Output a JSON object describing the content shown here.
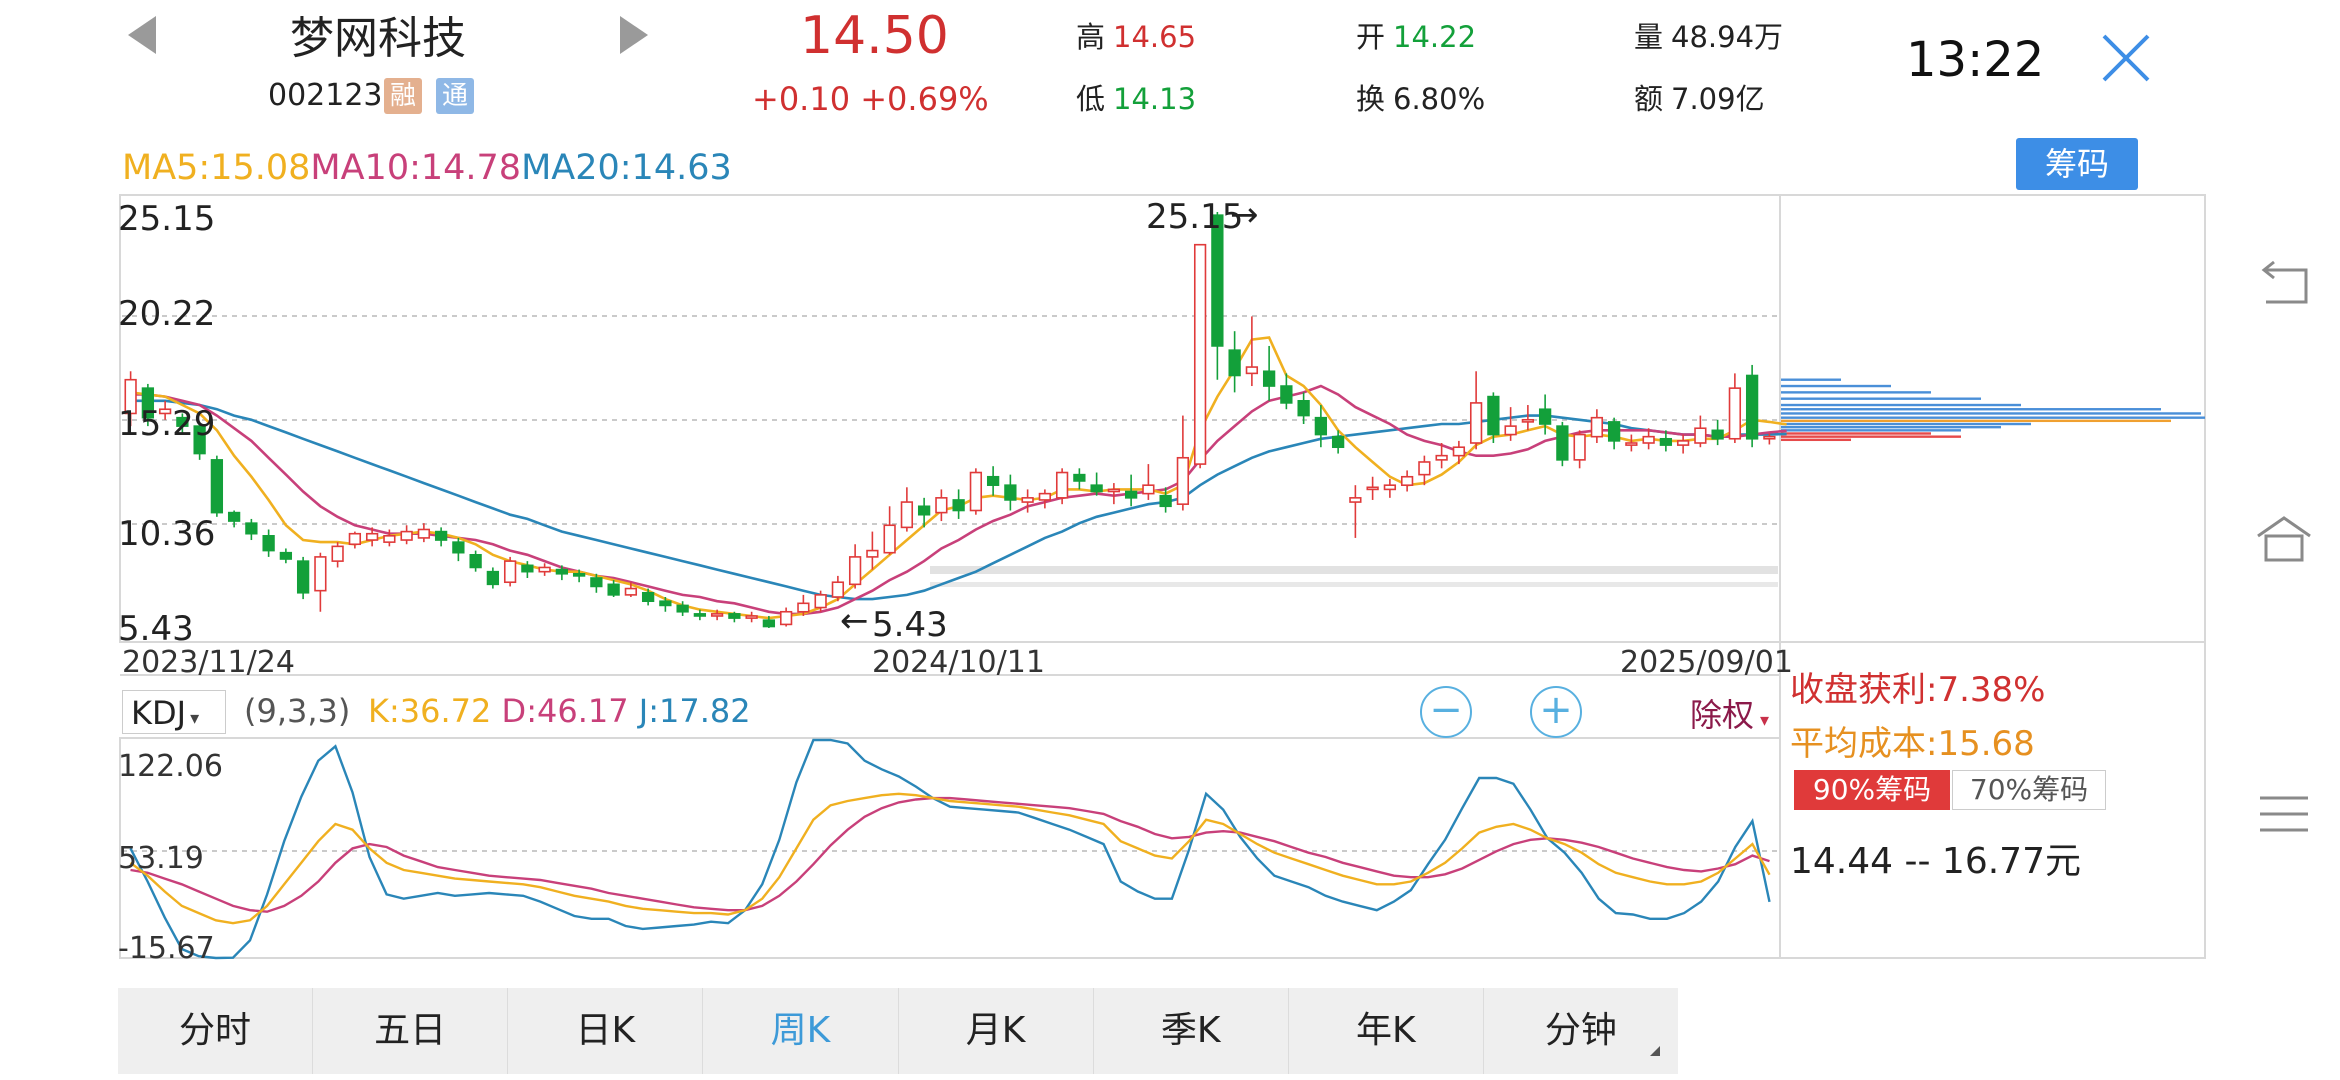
{
  "header": {
    "stock_name": "梦网科技",
    "stock_code": "002123",
    "tags": [
      "融",
      "通"
    ],
    "price": "14.50",
    "change": "+0.10  +0.69%",
    "high_label": "高",
    "high_value": "14.65",
    "low_label": "低",
    "low_value": "14.13",
    "open_label": "开",
    "open_value": "14.22",
    "turnover_label": "换",
    "turnover_value": "6.80%",
    "volume_label": "量",
    "volume_value": "48.94万",
    "amount_label": "额",
    "amount_value": "7.09亿",
    "time": "13:22"
  },
  "ma_legend": {
    "ma5": "MA5:15.08",
    "ma10": "MA10:14.78",
    "ma20": "MA20:14.63",
    "colors": {
      "ma5": "#f0b020",
      "ma10": "#c8407a",
      "ma20": "#2a86b8"
    }
  },
  "chip_button": "筹码",
  "price_axis": [
    "25.15",
    "20.22",
    "15.29",
    "10.36",
    "5.43"
  ],
  "dates": [
    "2023/11/24",
    "2024/10/11",
    "2025/09/01"
  ],
  "annotations": {
    "max": "25.15",
    "min": "5.43"
  },
  "kdj": {
    "selector": "KDJ",
    "params": "(9,3,3)",
    "k": "K:36.72",
    "d": "D:46.17",
    "j": "J:17.82",
    "axis": [
      "122.06",
      "53.19",
      "-15.67"
    ]
  },
  "rights_label": "除权",
  "chip_panel": {
    "profit": "收盘获利:7.38%",
    "avg_cost": "平均成本:15.68",
    "tab90": "90%筹码",
    "tab70": "70%筹码",
    "range": "14.44  --   16.77元"
  },
  "tabs": [
    "分时",
    "五日",
    "日K",
    "周K",
    "月K",
    "季K",
    "年K",
    "分钟"
  ],
  "active_tab": "周K",
  "colors": {
    "up": "#e03a3a",
    "down": "#13a03a",
    "accent": "#3d8ee6"
  },
  "chart_data": {
    "type": "candlestick",
    "period": "weekly",
    "ylim": [
      5.43,
      25.15
    ],
    "candles": [
      {
        "o": 15.6,
        "c": 17.2,
        "h": 17.6,
        "l": 15.0
      },
      {
        "o": 16.8,
        "c": 15.4,
        "h": 17.0,
        "l": 15.0
      },
      {
        "o": 15.6,
        "c": 15.8,
        "h": 16.2,
        "l": 15.3
      },
      {
        "o": 15.4,
        "c": 15.0,
        "h": 15.6,
        "l": 14.7
      },
      {
        "o": 15.0,
        "c": 13.7,
        "h": 15.2,
        "l": 13.4
      },
      {
        "o": 13.4,
        "c": 10.9,
        "h": 13.6,
        "l": 10.7
      },
      {
        "o": 10.9,
        "c": 10.5,
        "h": 11.0,
        "l": 10.2
      },
      {
        "o": 10.4,
        "c": 9.9,
        "h": 10.6,
        "l": 9.6
      },
      {
        "o": 9.8,
        "c": 9.1,
        "h": 10.1,
        "l": 8.8
      },
      {
        "o": 9.0,
        "c": 8.7,
        "h": 9.2,
        "l": 8.5
      },
      {
        "o": 8.6,
        "c": 7.1,
        "h": 8.8,
        "l": 6.8
      },
      {
        "o": 7.2,
        "c": 8.8,
        "h": 9.0,
        "l": 6.2
      },
      {
        "o": 8.6,
        "c": 9.3,
        "h": 9.5,
        "l": 8.3
      },
      {
        "o": 9.4,
        "c": 9.9,
        "h": 10.0,
        "l": 9.2
      },
      {
        "o": 9.6,
        "c": 9.9,
        "h": 10.2,
        "l": 9.3
      },
      {
        "o": 9.5,
        "c": 9.8,
        "h": 10.1,
        "l": 9.3
      },
      {
        "o": 9.6,
        "c": 10.0,
        "h": 10.3,
        "l": 9.4
      },
      {
        "o": 9.7,
        "c": 10.1,
        "h": 10.4,
        "l": 9.5
      },
      {
        "o": 10.0,
        "c": 9.6,
        "h": 10.2,
        "l": 9.3
      },
      {
        "o": 9.5,
        "c": 9.0,
        "h": 9.7,
        "l": 8.6
      },
      {
        "o": 8.9,
        "c": 8.3,
        "h": 9.1,
        "l": 8.1
      },
      {
        "o": 8.1,
        "c": 7.5,
        "h": 8.3,
        "l": 7.3
      },
      {
        "o": 7.6,
        "c": 8.6,
        "h": 8.8,
        "l": 7.4
      },
      {
        "o": 8.4,
        "c": 8.1,
        "h": 8.6,
        "l": 7.8
      },
      {
        "o": 8.1,
        "c": 8.3,
        "h": 8.5,
        "l": 7.9
      },
      {
        "o": 8.2,
        "c": 8.0,
        "h": 8.4,
        "l": 7.7
      },
      {
        "o": 8.0,
        "c": 7.9,
        "h": 8.2,
        "l": 7.6
      },
      {
        "o": 7.8,
        "c": 7.4,
        "h": 8.0,
        "l": 7.1
      },
      {
        "o": 7.5,
        "c": 7.0,
        "h": 7.7,
        "l": 6.9
      },
      {
        "o": 7.0,
        "c": 7.3,
        "h": 7.6,
        "l": 6.9
      },
      {
        "o": 7.1,
        "c": 6.7,
        "h": 7.3,
        "l": 6.5
      },
      {
        "o": 6.7,
        "c": 6.5,
        "h": 6.9,
        "l": 6.2
      },
      {
        "o": 6.5,
        "c": 6.2,
        "h": 6.7,
        "l": 6.0
      },
      {
        "o": 6.1,
        "c": 6.0,
        "h": 6.3,
        "l": 5.8
      },
      {
        "o": 6.0,
        "c": 6.1,
        "h": 6.3,
        "l": 5.8
      },
      {
        "o": 6.1,
        "c": 5.9,
        "h": 6.2,
        "l": 5.7
      },
      {
        "o": 5.9,
        "c": 6.0,
        "h": 6.2,
        "l": 5.7
      },
      {
        "o": 5.8,
        "c": 5.5,
        "h": 6.0,
        "l": 5.43
      },
      {
        "o": 5.6,
        "c": 6.2,
        "h": 6.4,
        "l": 5.5
      },
      {
        "o": 6.2,
        "c": 6.6,
        "h": 7.0,
        "l": 6.0
      },
      {
        "o": 6.4,
        "c": 7.0,
        "h": 7.2,
        "l": 6.2
      },
      {
        "o": 6.9,
        "c": 7.6,
        "h": 7.9,
        "l": 6.7
      },
      {
        "o": 7.5,
        "c": 8.8,
        "h": 9.4,
        "l": 7.3
      },
      {
        "o": 8.8,
        "c": 9.1,
        "h": 10.0,
        "l": 8.2
      },
      {
        "o": 9.0,
        "c": 10.3,
        "h": 11.2,
        "l": 8.9
      },
      {
        "o": 10.2,
        "c": 11.4,
        "h": 12.1,
        "l": 10.0
      },
      {
        "o": 11.2,
        "c": 10.8,
        "h": 11.6,
        "l": 10.2
      },
      {
        "o": 10.9,
        "c": 11.6,
        "h": 12.0,
        "l": 10.5
      },
      {
        "o": 11.5,
        "c": 11.0,
        "h": 12.0,
        "l": 10.6
      },
      {
        "o": 11.0,
        "c": 12.8,
        "h": 13.0,
        "l": 10.8
      },
      {
        "o": 12.6,
        "c": 12.2,
        "h": 13.1,
        "l": 11.7
      },
      {
        "o": 12.2,
        "c": 11.5,
        "h": 12.7,
        "l": 11.0
      },
      {
        "o": 11.4,
        "c": 11.6,
        "h": 12.0,
        "l": 10.9
      },
      {
        "o": 11.5,
        "c": 11.8,
        "h": 12.0,
        "l": 11.1
      },
      {
        "o": 11.6,
        "c": 12.8,
        "h": 13.0,
        "l": 11.3
      },
      {
        "o": 12.7,
        "c": 12.4,
        "h": 13.0,
        "l": 12.0
      },
      {
        "o": 12.2,
        "c": 11.9,
        "h": 12.8,
        "l": 11.7
      },
      {
        "o": 11.9,
        "c": 12.0,
        "h": 12.3,
        "l": 11.3
      },
      {
        "o": 11.9,
        "c": 11.6,
        "h": 12.7,
        "l": 11.2
      },
      {
        "o": 11.8,
        "c": 12.2,
        "h": 13.2,
        "l": 11.5
      },
      {
        "o": 11.7,
        "c": 11.2,
        "h": 12.1,
        "l": 10.9
      },
      {
        "o": 11.3,
        "c": 13.5,
        "h": 15.5,
        "l": 11.0
      },
      {
        "o": 13.2,
        "c": 23.6,
        "h": 23.6,
        "l": 13.0
      },
      {
        "o": 25.0,
        "c": 18.8,
        "h": 25.15,
        "l": 17.2
      },
      {
        "o": 18.6,
        "c": 17.4,
        "h": 19.5,
        "l": 16.6
      },
      {
        "o": 17.5,
        "c": 17.8,
        "h": 20.2,
        "l": 16.9
      },
      {
        "o": 17.6,
        "c": 16.9,
        "h": 18.8,
        "l": 16.2
      },
      {
        "o": 16.9,
        "c": 16.1,
        "h": 17.5,
        "l": 15.8
      },
      {
        "o": 16.2,
        "c": 15.5,
        "h": 16.6,
        "l": 15.1
      },
      {
        "o": 15.4,
        "c": 14.6,
        "h": 16.0,
        "l": 14.0
      },
      {
        "o": 14.5,
        "c": 14.0,
        "h": 14.8,
        "l": 13.7
      },
      {
        "o": 11.4,
        "c": 11.6,
        "h": 12.2,
        "l": 9.7
      },
      {
        "o": 12.0,
        "c": 12.1,
        "h": 12.6,
        "l": 11.5
      },
      {
        "o": 12.0,
        "c": 12.2,
        "h": 12.5,
        "l": 11.6
      },
      {
        "o": 12.2,
        "c": 12.6,
        "h": 12.9,
        "l": 11.9
      },
      {
        "o": 12.7,
        "c": 13.3,
        "h": 13.6,
        "l": 12.2
      },
      {
        "o": 13.4,
        "c": 13.6,
        "h": 14.2,
        "l": 13.0
      },
      {
        "o": 13.6,
        "c": 14.0,
        "h": 14.3,
        "l": 13.2
      },
      {
        "o": 14.2,
        "c": 16.1,
        "h": 17.6,
        "l": 13.9
      },
      {
        "o": 16.4,
        "c": 14.6,
        "h": 16.6,
        "l": 14.2
      },
      {
        "o": 14.6,
        "c": 15.0,
        "h": 15.9,
        "l": 14.3
      },
      {
        "o": 15.2,
        "c": 15.3,
        "h": 16.0,
        "l": 14.8
      },
      {
        "o": 15.8,
        "c": 15.1,
        "h": 16.5,
        "l": 14.6
      },
      {
        "o": 15.0,
        "c": 13.4,
        "h": 15.2,
        "l": 13.1
      },
      {
        "o": 13.4,
        "c": 14.6,
        "h": 14.8,
        "l": 13.0
      },
      {
        "o": 14.5,
        "c": 15.4,
        "h": 15.8,
        "l": 14.2
      },
      {
        "o": 15.2,
        "c": 14.3,
        "h": 15.4,
        "l": 13.9
      },
      {
        "o": 14.1,
        "c": 14.2,
        "h": 14.6,
        "l": 13.8
      },
      {
        "o": 14.2,
        "c": 14.5,
        "h": 14.9,
        "l": 13.9
      },
      {
        "o": 14.4,
        "c": 14.1,
        "h": 14.8,
        "l": 13.8
      },
      {
        "o": 14.1,
        "c": 14.3,
        "h": 14.6,
        "l": 13.7
      },
      {
        "o": 14.2,
        "c": 14.9,
        "h": 15.5,
        "l": 14.0
      },
      {
        "o": 14.8,
        "c": 14.4,
        "h": 15.3,
        "l": 14.1
      },
      {
        "o": 14.4,
        "c": 16.8,
        "h": 17.5,
        "l": 14.2
      },
      {
        "o": 17.4,
        "c": 14.4,
        "h": 17.9,
        "l": 14.0
      },
      {
        "o": 14.4,
        "c": 14.5,
        "h": 14.65,
        "l": 14.13
      }
    ],
    "ma5": [
      16.6,
      16.5,
      16.4,
      16.0,
      15.6,
      14.8,
      13.6,
      12.6,
      11.5,
      10.3,
      9.6,
      9.5,
      9.5,
      9.4,
      9.6,
      9.8,
      9.9,
      10.0,
      9.9,
      9.7,
      9.4,
      8.9,
      8.6,
      8.4,
      8.2,
      8.1,
      8.1,
      7.9,
      7.7,
      7.5,
      7.2,
      6.8,
      6.5,
      6.3,
      6.2,
      6.1,
      6.0,
      5.9,
      6.0,
      6.1,
      6.4,
      6.8,
      7.5,
      8.2,
      8.9,
      9.6,
      10.3,
      11.0,
      11.2,
      11.6,
      11.7,
      11.6,
      11.5,
      11.6,
      12.0,
      12.0,
      11.9,
      12.0,
      12.0,
      12.0,
      11.8,
      12.2,
      14.8,
      16.4,
      17.7,
      19.1,
      19.2,
      17.4,
      16.9,
      16.0,
      14.8,
      14.0,
      13.3,
      12.6,
      12.2,
      12.3,
      12.7,
      13.3,
      14.1,
      14.5,
      14.6,
      14.8,
      15.0,
      14.6,
      14.5,
      14.6,
      14.5,
      14.3,
      14.4,
      14.3,
      14.3,
      14.4,
      14.4,
      14.8,
      15.3,
      15.2,
      15.08
    ],
    "ma10": [
      16.5,
      16.5,
      16.4,
      16.2,
      16.0,
      15.5,
      14.9,
      14.3,
      13.5,
      12.7,
      11.9,
      11.2,
      10.7,
      10.3,
      10.1,
      9.9,
      9.9,
      9.9,
      9.8,
      9.7,
      9.6,
      9.4,
      9.1,
      8.9,
      8.6,
      8.3,
      8.1,
      7.9,
      7.8,
      7.6,
      7.4,
      7.2,
      7.0,
      6.9,
      6.7,
      6.6,
      6.4,
      6.2,
      6.1,
      6.1,
      6.2,
      6.4,
      6.8,
      7.2,
      7.7,
      8.1,
      8.6,
      9.2,
      9.6,
      10.1,
      10.5,
      10.8,
      11.2,
      11.4,
      11.6,
      11.7,
      11.8,
      11.7,
      11.8,
      11.9,
      12.0,
      12.4,
      13.4,
      14.3,
      15.0,
      15.7,
      16.2,
      16.4,
      16.6,
      16.9,
      16.5,
      15.9,
      15.5,
      15.1,
      14.6,
      14.3,
      14.1,
      13.8,
      13.6,
      13.6,
      13.7,
      13.9,
      14.3,
      14.5,
      14.7,
      14.8,
      14.8,
      14.8,
      14.8,
      14.7,
      14.6,
      14.6,
      14.5,
      14.5,
      14.6,
      14.7,
      14.78
    ],
    "ma20": [
      16.2,
      16.2,
      16.2,
      16.1,
      16.0,
      15.8,
      15.5,
      15.3,
      15.0,
      14.7,
      14.4,
      14.1,
      13.8,
      13.5,
      13.2,
      12.9,
      12.6,
      12.3,
      12.0,
      11.7,
      11.4,
      11.1,
      10.8,
      10.6,
      10.3,
      10.0,
      9.8,
      9.6,
      9.4,
      9.2,
      9.0,
      8.8,
      8.6,
      8.4,
      8.2,
      8.0,
      7.8,
      7.6,
      7.4,
      7.2,
      7.0,
      6.9,
      6.8,
      6.8,
      6.9,
      7.0,
      7.2,
      7.5,
      7.8,
      8.1,
      8.5,
      8.9,
      9.3,
      9.7,
      10.0,
      10.4,
      10.7,
      10.9,
      11.1,
      11.3,
      11.4,
      11.6,
      12.2,
      12.7,
      13.1,
      13.5,
      13.8,
      14.0,
      14.2,
      14.4,
      14.5,
      14.6,
      14.7,
      14.8,
      14.9,
      15.0,
      15.1,
      15.1,
      15.2,
      15.3,
      15.4,
      15.5,
      15.5,
      15.4,
      15.3,
      15.2,
      15.1,
      14.9,
      14.8,
      14.7,
      14.6,
      14.6,
      14.5,
      14.6,
      14.6,
      14.6,
      14.63
    ],
    "kdj": {
      "ylim": [
        -15.67,
        122.06
      ],
      "k": [
        45,
        36,
        25,
        15,
        10,
        5,
        3,
        5,
        15,
        30,
        45,
        60,
        72,
        68,
        55,
        45,
        40,
        38,
        36,
        34,
        33,
        32,
        31,
        30,
        28,
        25,
        22,
        20,
        18,
        15,
        13,
        12,
        11,
        10,
        10,
        9,
        12,
        20,
        35,
        55,
        75,
        85,
        88,
        90,
        92,
        93,
        92,
        90,
        88,
        87,
        86,
        85,
        84,
        82,
        80,
        78,
        75,
        72,
        60,
        55,
        50,
        48,
        60,
        75,
        72,
        65,
        58,
        52,
        48,
        44,
        40,
        36,
        33,
        30,
        30,
        32,
        38,
        45,
        55,
        66,
        70,
        72,
        68,
        62,
        58,
        52,
        44,
        38,
        35,
        32,
        30,
        30,
        32,
        38,
        48,
        58,
        36.72
      ],
      "d": [
        40,
        38,
        34,
        30,
        25,
        20,
        15,
        12,
        11,
        15,
        22,
        32,
        45,
        55,
        58,
        56,
        50,
        46,
        42,
        40,
        38,
        36,
        35,
        34,
        33,
        31,
        29,
        27,
        24,
        22,
        20,
        18,
        16,
        14,
        13,
        12,
        12,
        15,
        22,
        32,
        44,
        57,
        68,
        77,
        83,
        87,
        89,
        90,
        90,
        89,
        88,
        87,
        86,
        85,
        84,
        83,
        81,
        79,
        74,
        70,
        65,
        62,
        63,
        66,
        67,
        66,
        63,
        60,
        56,
        52,
        49,
        45,
        42,
        39,
        36,
        35,
        35,
        37,
        41,
        47,
        53,
        58,
        61,
        62,
        61,
        59,
        56,
        52,
        48,
        45,
        42,
        40,
        39,
        41,
        44,
        50,
        46.17
      ],
      "j": [
        55,
        32,
        7,
        -15,
        -20,
        -25,
        -21,
        -9,
        23,
        60,
        91,
        116,
        126,
        94,
        49,
        23,
        20,
        22,
        24,
        22,
        23,
        24,
        23,
        22,
        18,
        13,
        8,
        6,
        6,
        1,
        -1,
        0,
        1,
        2,
        4,
        3,
        12,
        30,
        61,
        101,
        137,
        141,
        128,
        116,
        110,
        105,
        98,
        90,
        84,
        83,
        82,
        81,
        80,
        76,
        72,
        68,
        63,
        58,
        32,
        25,
        20,
        20,
        54,
        93,
        82,
        63,
        48,
        36,
        32,
        28,
        22,
        18,
        15,
        12,
        18,
        26,
        44,
        61,
        83,
        104,
        104,
        100,
        82,
        62,
        52,
        38,
        20,
        10,
        9,
        6,
        6,
        10,
        18,
        32,
        56,
        74,
        17.82
      ]
    }
  }
}
